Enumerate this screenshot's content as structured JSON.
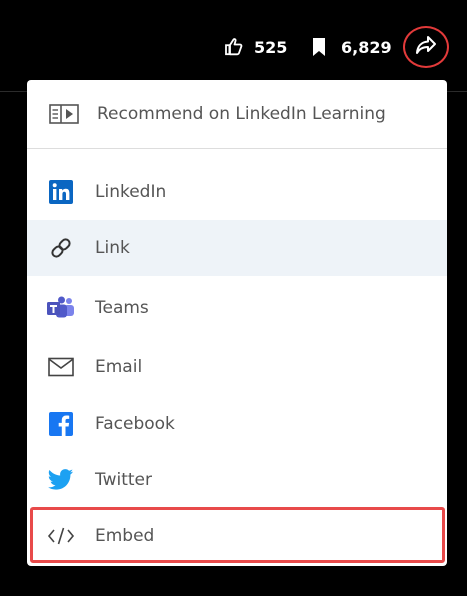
{
  "stats": {
    "likes": "525",
    "saves": "6,829"
  },
  "share_menu": {
    "items": [
      {
        "label": "Recommend on LinkedIn Learning",
        "icon": "recommend-icon"
      },
      {
        "label": "LinkedIn",
        "icon": "linkedin-icon"
      },
      {
        "label": "Link",
        "icon": "link-icon"
      },
      {
        "label": "Teams",
        "icon": "teams-icon"
      },
      {
        "label": "Email",
        "icon": "email-icon"
      },
      {
        "label": "Facebook",
        "icon": "facebook-icon"
      },
      {
        "label": "Twitter",
        "icon": "twitter-icon"
      },
      {
        "label": "Embed",
        "icon": "embed-icon"
      }
    ]
  },
  "colors": {
    "topbar_background": "#000000",
    "highlight": "#e84a4a",
    "hover_background": "#eef3f8",
    "linkedin": "#0a66c2",
    "teams": "#5059c9",
    "facebook": "#1877f2",
    "twitter": "#1da1f2"
  }
}
